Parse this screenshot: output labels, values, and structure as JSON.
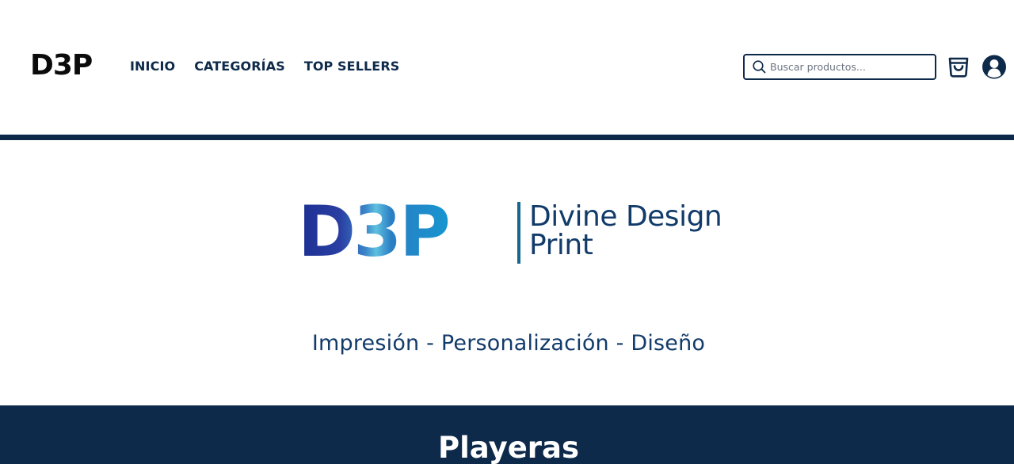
{
  "header": {
    "logo_text": "D3P",
    "nav": [
      {
        "label": "INICIO"
      },
      {
        "label": "CATEGORÍAS"
      },
      {
        "label": "TOP SELLERS"
      }
    ],
    "search": {
      "placeholder": "Buscar productos...",
      "value": ""
    },
    "icons": {
      "search": "search-icon",
      "cart": "shopping-bag-icon",
      "user": "user-account-icon"
    }
  },
  "hero": {
    "brand_mark": "D3P",
    "brand_line1": "Divine Design",
    "brand_line2": "Print",
    "tagline": "Impresión - Personalización - Diseño"
  },
  "section": {
    "title": "Playeras"
  },
  "colors": {
    "navy": "#0e2a4a",
    "brand_text": "#123b6a",
    "brand_bar": "#13688c",
    "gradient_start": "#1c2f92",
    "gradient_end": "#1696cf"
  }
}
